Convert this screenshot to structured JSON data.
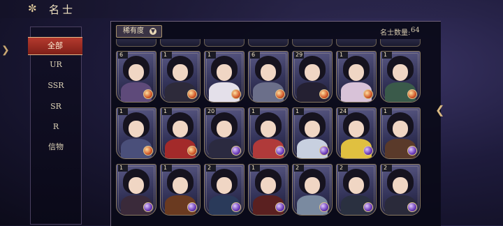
{
  "header": {
    "title": "名士",
    "icon": "swirl-cloud-icon"
  },
  "menu": {
    "items": [
      {
        "label": "全部",
        "active": true
      },
      {
        "label": "UR",
        "active": false
      },
      {
        "label": "SSR",
        "active": false
      },
      {
        "label": "SR",
        "active": false
      },
      {
        "label": "R",
        "active": false
      },
      {
        "label": "信物",
        "active": false
      }
    ]
  },
  "filter": {
    "label": "稀有度",
    "icon": "chevron-down-icon"
  },
  "count": {
    "label": "名士数量:",
    "value": "64"
  },
  "cards": [
    {
      "num": "6",
      "orb": "fire"
    },
    {
      "num": "1",
      "orb": "fire"
    },
    {
      "num": "1",
      "orb": "fire"
    },
    {
      "num": "6",
      "orb": "fire"
    },
    {
      "num": "29",
      "orb": "fire"
    },
    {
      "num": "1",
      "orb": "fire"
    },
    {
      "num": "1",
      "orb": "fire"
    },
    {
      "num": "1",
      "orb": "fire"
    },
    {
      "num": "1",
      "orb": "fire"
    },
    {
      "num": "20",
      "orb": "violet"
    },
    {
      "num": "1",
      "orb": "violet"
    },
    {
      "num": "1",
      "orb": "violet"
    },
    {
      "num": "24",
      "orb": "violet"
    },
    {
      "num": "1",
      "orb": "violet"
    },
    {
      "num": "1",
      "orb": "violet"
    },
    {
      "num": "1",
      "orb": "violet"
    },
    {
      "num": "2",
      "orb": "violet"
    },
    {
      "num": "1",
      "orb": "violet"
    },
    {
      "num": "2",
      "orb": "violet"
    },
    {
      "num": "2",
      "orb": "violet"
    },
    {
      "num": "2",
      "orb": "violet"
    }
  ],
  "colors": {
    "accent_red": "#b53a2e",
    "gold": "#d9b982",
    "panel": "#0a0a18"
  }
}
